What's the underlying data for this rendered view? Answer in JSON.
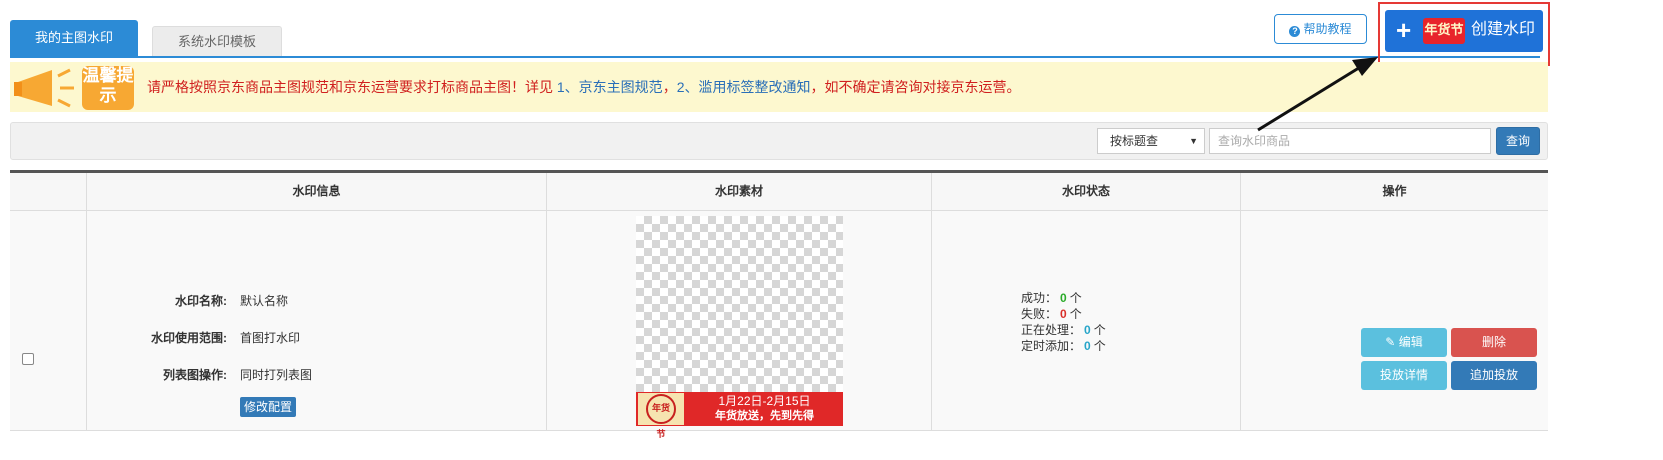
{
  "tabs": [
    "我的主图水印",
    "系统水印模板"
  ],
  "help_label": "帮助教程",
  "create": {
    "badge": "年货节",
    "label": "创建水印"
  },
  "notice": {
    "icon_text": "温馨提示",
    "before": "请严格按照京东商品主图规范和京东运营要求打标商品主图！详见 ",
    "link1": "1、京东主图规范",
    "sep": "，",
    "link2": "2、滥用标签整改通知",
    "after": "，如不确定请咨询对接京东运营。"
  },
  "search": {
    "select_value": "按标题查",
    "placeholder": "查询水印商品",
    "button": "查询"
  },
  "table": {
    "headers": [
      "水印信息",
      "水印素材",
      "水印状态",
      "操作"
    ],
    "row": {
      "info": [
        {
          "key": "水印名称:",
          "value": "默认名称"
        },
        {
          "key": "水印使用范围:",
          "value": "首图打水印"
        },
        {
          "key": "列表图操作:",
          "value": "同时打列表图"
        }
      ],
      "config_button": "修改配置",
      "material": {
        "seal": "年货节",
        "line1": "1月22日-2月15日",
        "line2": "年货放送，先到先得"
      },
      "status": [
        {
          "label": "成功：",
          "count": "0",
          "unit": "个"
        },
        {
          "label": "失败：",
          "count": "0",
          "unit": "个"
        },
        {
          "label": "正在处理：",
          "count": "0",
          "unit": "个"
        },
        {
          "label": "定时添加：",
          "count": "0",
          "unit": "个"
        }
      ],
      "actions": {
        "edit": "编辑",
        "delete": "删除",
        "detail": "投放详情",
        "add": "追加投放"
      }
    }
  }
}
